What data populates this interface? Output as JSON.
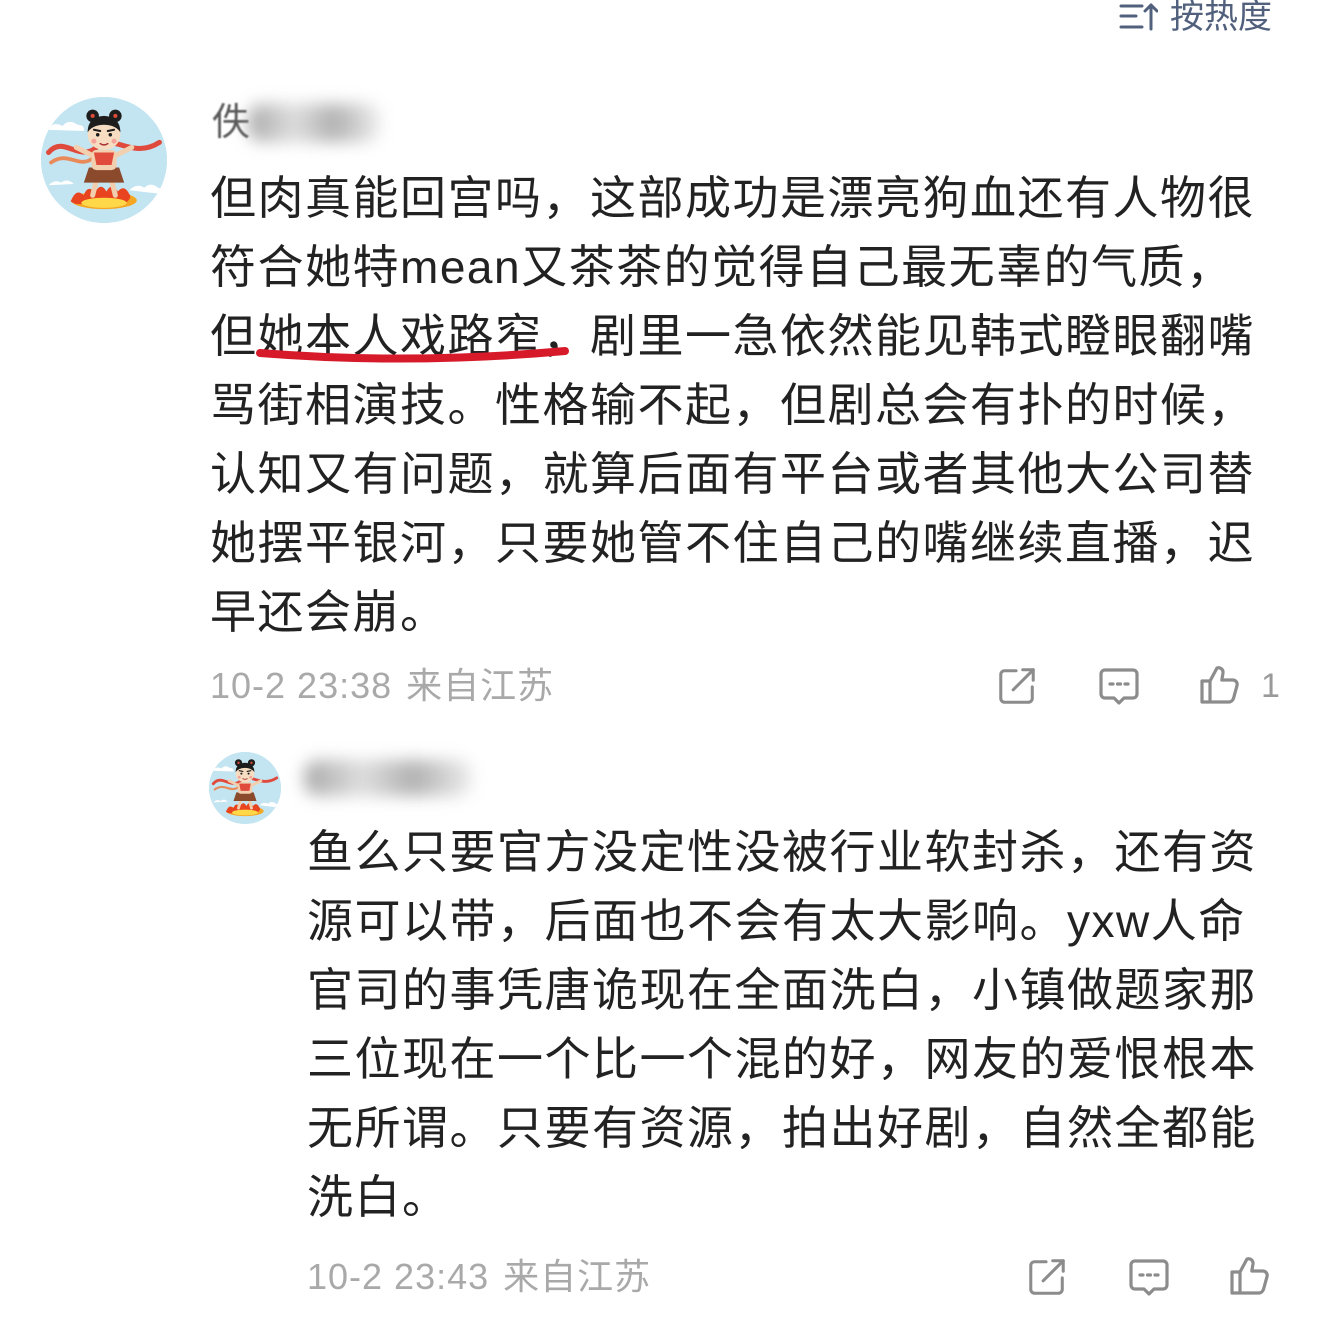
{
  "colors": {
    "text": "#222222",
    "meta": "#a9a9a9",
    "icon": "#8c8c8c",
    "sort": "#51607c",
    "underline_mark": "#d71a2a"
  },
  "sort": {
    "icon": "sort-icon",
    "label": "按热度"
  },
  "comments": [
    {
      "user": {
        "avatar": "cartoon-avatar",
        "name_visible": "佚"
      },
      "lines": [
        "但肉真能回宫吗，这部成功是漂亮狗血还有人物很",
        "符合她特mean又茶茶的觉得自己最无辜的气质，",
        {
          "before": "但",
          "highlight": "她本人戏路窄，",
          "after": "剧里一急依然能见韩式瞪眼翻嘴"
        },
        "骂街相演技。性格输不起，但剧总会有扑的时候，",
        "认知又有问题，就算后面有平台或者其他大公司替",
        "她摆平银河，只要她管不住自己的嘴继续直播，迟",
        "早还会崩。"
      ],
      "time": "10-2 23:38",
      "location": "来自江苏",
      "actions": {
        "share_icon": "share-icon",
        "comment_icon": "comment-icon",
        "like_icon": "like-icon",
        "like_count": "1"
      }
    },
    {
      "user": {
        "avatar": "cartoon-avatar"
      },
      "lines": [
        "鱼么只要官方没定性没被行业软封杀，还有资",
        "源可以带，后面也不会有太大影响。yxw人命",
        "官司的事凭唐诡现在全面洗白，小镇做题家那",
        "三位现在一个比一个混的好，网友的爱恨根本",
        "无所谓。只要有资源，拍出好剧，自然全都能",
        "洗白。"
      ],
      "time": "10-2 23:43",
      "location": "来自江苏",
      "actions": {
        "share_icon": "share-icon",
        "comment_icon": "comment-icon",
        "like_icon": "like-icon"
      }
    }
  ]
}
